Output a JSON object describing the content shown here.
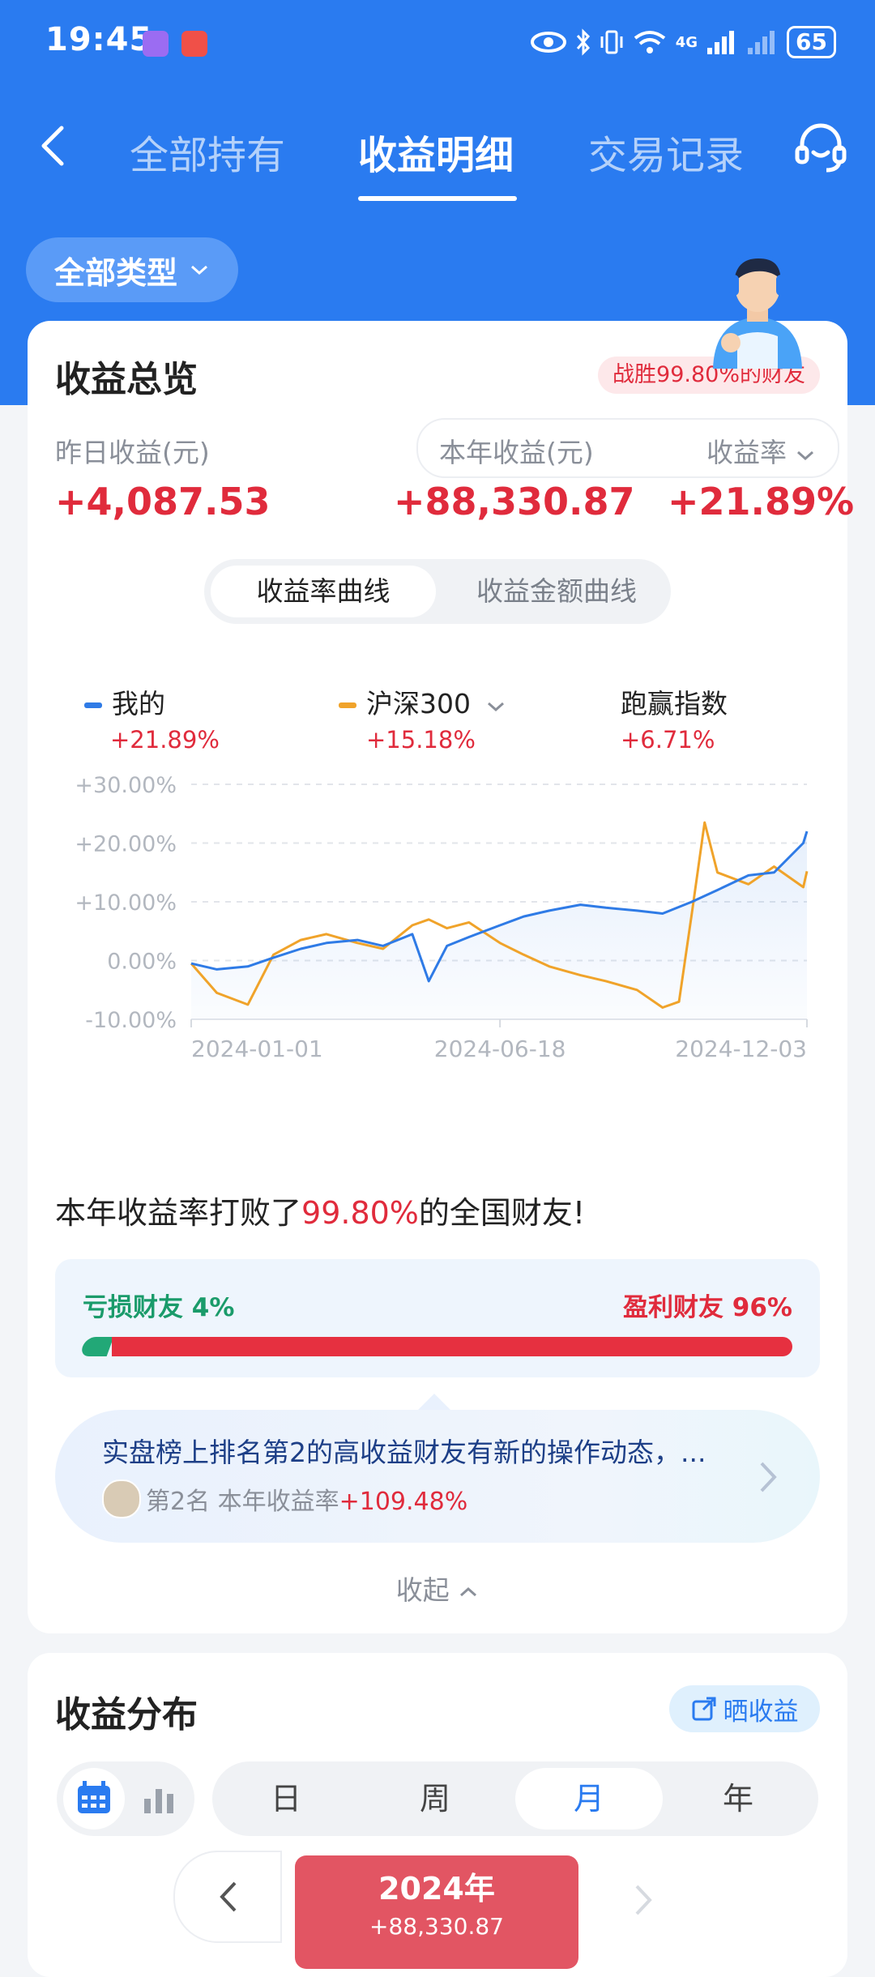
{
  "status_bar": {
    "time": "19:45",
    "network": "4G",
    "battery": "65"
  },
  "nav": {
    "tabs": [
      {
        "label": "全部持有"
      },
      {
        "label": "收益明细"
      },
      {
        "label": "交易记录"
      }
    ]
  },
  "filter": {
    "type_label": "全部类型"
  },
  "overview": {
    "title": "收益总览",
    "win_badge": "战胜99.80%的财友",
    "yesterday_label": "昨日收益(元)",
    "yesterday_value": "+4,087.53",
    "year_label": "本年收益(元)",
    "year_value": "+88,330.87",
    "rate_label": "收益率",
    "rate_value": "+21.89%",
    "curve_tabs": [
      "收益率曲线",
      "收益金额曲线"
    ]
  },
  "legend": [
    {
      "name": "我的",
      "value": "+21.89%",
      "color": "#2f7be6"
    },
    {
      "name": "沪深300",
      "value": "+15.18%",
      "color": "#f0a32a"
    },
    {
      "name": "跑赢指数",
      "value": "+6.71%"
    }
  ],
  "chart_data": {
    "type": "line",
    "ylim": [
      -10,
      30
    ],
    "y_ticks": [
      "+30.00%",
      "+20.00%",
      "+10.00%",
      "0.00%",
      "-10.00%"
    ],
    "x_ticks": [
      "2024-01-01",
      "2024-06-18",
      "2024-12-03"
    ],
    "series": [
      {
        "name": "我的",
        "color": "#2f7be6",
        "x": [
          "2024-01-01",
          "2024-01-15",
          "2024-02-01",
          "2024-02-15",
          "2024-03-01",
          "2024-03-15",
          "2024-04-01",
          "2024-04-15",
          "2024-05-01",
          "2024-05-10",
          "2024-05-20",
          "2024-06-01",
          "2024-06-18",
          "2024-07-01",
          "2024-07-15",
          "2024-08-01",
          "2024-08-15",
          "2024-09-01",
          "2024-09-15",
          "2024-10-01",
          "2024-10-08",
          "2024-10-15",
          "2024-11-01",
          "2024-11-15",
          "2024-12-01",
          "2024-12-03"
        ],
        "values": [
          -0.5,
          -1.5,
          -1.0,
          0.5,
          2.0,
          3.0,
          3.5,
          2.5,
          4.5,
          -3.5,
          2.5,
          4.0,
          6.0,
          7.5,
          8.5,
          9.5,
          9.0,
          8.5,
          8.0,
          10.0,
          11.0,
          12.0,
          14.5,
          15.0,
          20.0,
          22.0
        ]
      },
      {
        "name": "沪深300",
        "color": "#f0a32a",
        "x": [
          "2024-01-01",
          "2024-01-15",
          "2024-02-01",
          "2024-02-15",
          "2024-03-01",
          "2024-03-15",
          "2024-04-01",
          "2024-04-15",
          "2024-05-01",
          "2024-05-10",
          "2024-05-20",
          "2024-06-01",
          "2024-06-18",
          "2024-07-01",
          "2024-07-15",
          "2024-08-01",
          "2024-08-15",
          "2024-09-01",
          "2024-09-15",
          "2024-09-24",
          "2024-10-01",
          "2024-10-08",
          "2024-10-15",
          "2024-11-01",
          "2024-11-15",
          "2024-12-01",
          "2024-12-03"
        ],
        "values": [
          -0.5,
          -5.5,
          -7.5,
          1.0,
          3.5,
          4.5,
          3.0,
          2.0,
          6.0,
          7.0,
          5.5,
          6.5,
          3.0,
          1.0,
          -1.0,
          -2.5,
          -3.5,
          -5.0,
          -8.0,
          -7.0,
          8.0,
          23.5,
          15.0,
          13.0,
          16.0,
          12.5,
          15.2
        ]
      }
    ]
  },
  "ranking": {
    "prefix": "本年收益率打败了",
    "percent": "99.80%",
    "suffix": "的全国财友!",
    "loss_label": "亏损财友 4%",
    "gain_label": "盈利财友 96%",
    "loss_share": 0.04,
    "gain_share": 0.96
  },
  "notice": {
    "title": "实盘榜上排名第2的高收益财友有新的操作动态，...",
    "rank_text": "第2名  本年收益率",
    "rank_value": "+109.48%"
  },
  "collapse_label": "收起",
  "distribution": {
    "title": "收益分布",
    "share_label": "晒收益",
    "periods": [
      "日",
      "周",
      "月",
      "年"
    ],
    "selected_period": "月",
    "year": "2024年",
    "year_value": "+88,330.87"
  }
}
